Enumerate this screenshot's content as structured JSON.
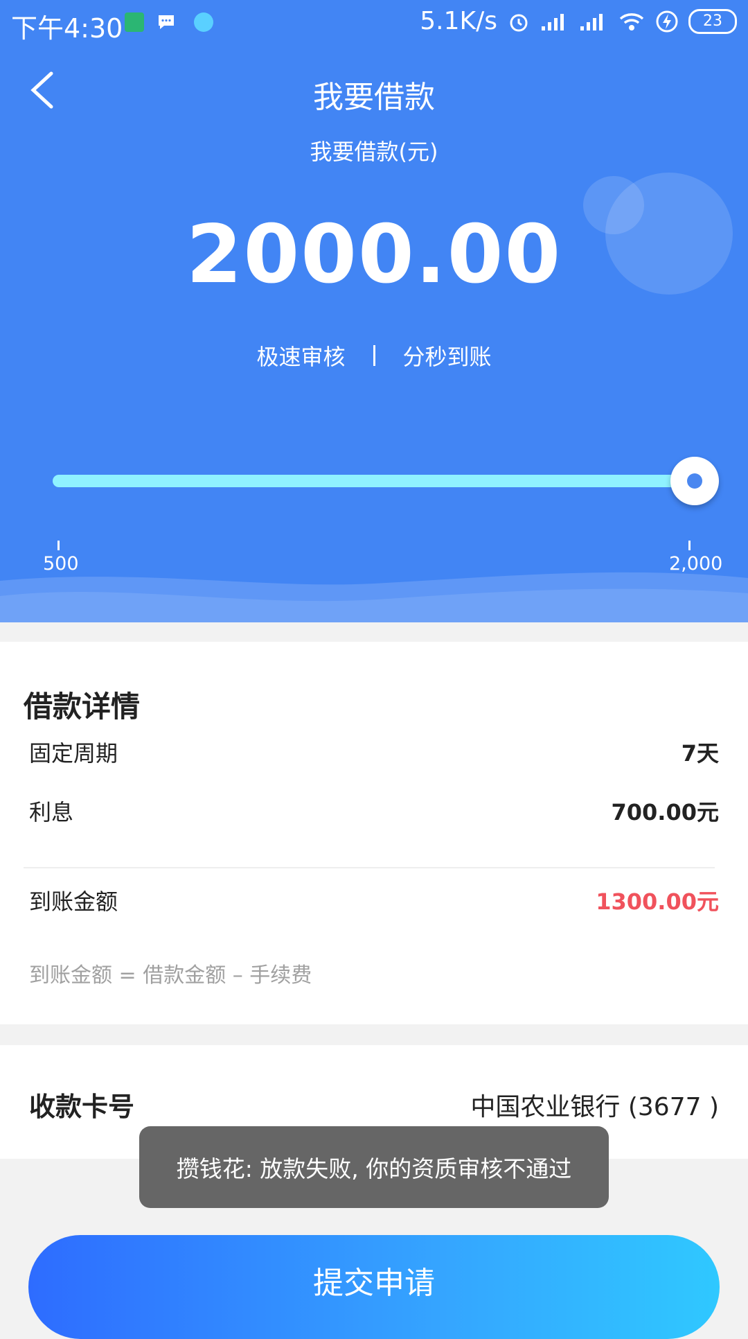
{
  "status_bar": {
    "time": "下午4:30",
    "network_speed": "5.1K/s",
    "battery_level": "23",
    "icons": [
      "download-notification-icon",
      "message-icon",
      "app-notification-icon",
      "alarm-icon",
      "signal-icon",
      "signal-icon",
      "wifi-icon",
      "charging-icon",
      "battery-icon"
    ]
  },
  "header": {
    "title": "我要借款",
    "subtitle": "我要借款(元)"
  },
  "loan": {
    "amount": "2000.00",
    "feature_1": "极速审核",
    "feature_2": "分秒到账",
    "slider": {
      "min_label": "500",
      "max_label": "2,000",
      "min": 500,
      "max": 2000,
      "value": 2000
    }
  },
  "details": {
    "section_title": "借款详情",
    "period_label": "固定周期",
    "period_value": "7天",
    "interest_label": "利息",
    "interest_value": "700.00元",
    "received_label": "到账金额",
    "received_value": "1300.00元",
    "formula": "到账金额 = 借款金额 – 手续费"
  },
  "card_section": {
    "label": "收款卡号",
    "value": "中国农业银行 (3677 )"
  },
  "toast": {
    "message": "攒钱花: 放款失败, 你的资质审核不通过"
  },
  "actions": {
    "submit_label": "提交申请"
  },
  "colors": {
    "primary": "#4285f4",
    "track": "#8ff2ff",
    "highlight_red": "#f0525c",
    "toast_bg": "#666666"
  }
}
